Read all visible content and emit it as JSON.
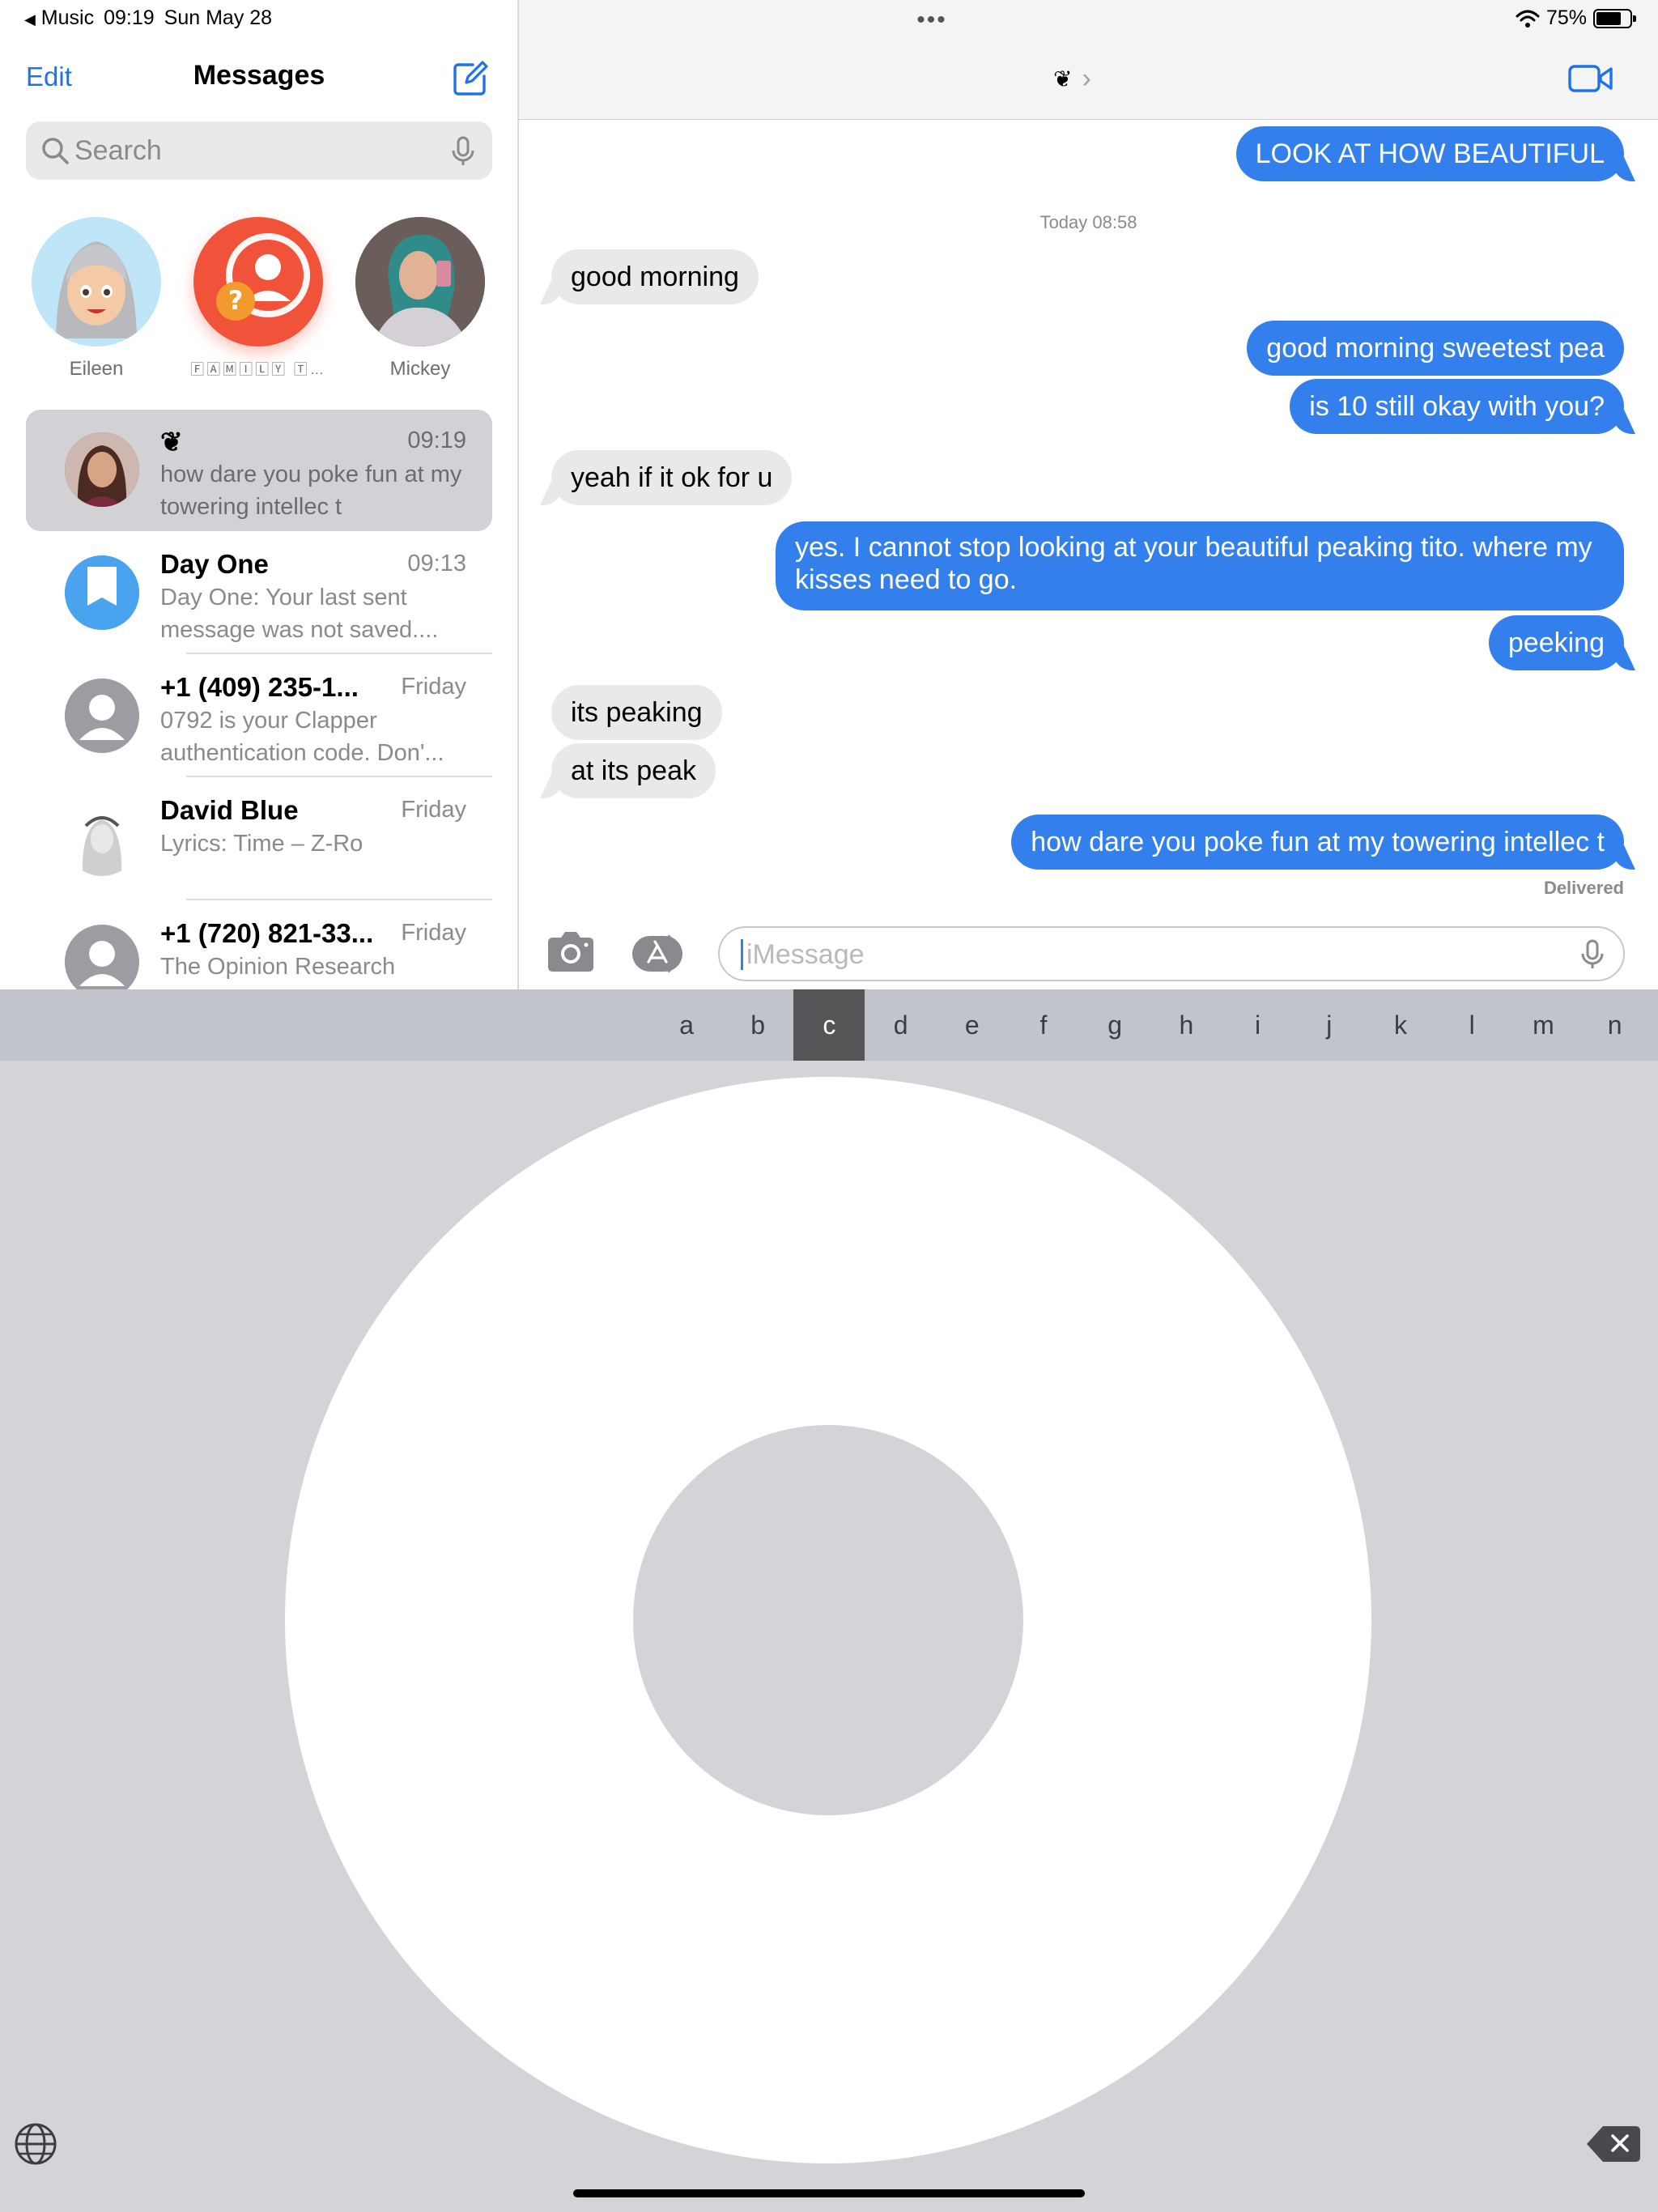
{
  "status_bar": {
    "back_app": "Music",
    "time": "09:19",
    "date": "Sun May 28",
    "battery": "75%",
    "battery_level": 0.75
  },
  "sidebar": {
    "edit_label": "Edit",
    "title": "Messages",
    "search_placeholder": "Search",
    "pinned": [
      {
        "name": "Eileen"
      },
      {
        "name": "🄵🄰🄼🄸🄻🅈 🅃…"
      },
      {
        "name": "Mickey"
      }
    ],
    "conversations": [
      {
        "name": "❦",
        "time": "09:19",
        "preview": "how dare you poke fun at my towering intellec t"
      },
      {
        "name": "Day One",
        "time": "09:13",
        "preview": "Day One: Your last sent message was not saved...."
      },
      {
        "name": "+1 (409) 235-1...",
        "time": "Friday",
        "preview": "0792 is your Clapper authentication code. Don'..."
      },
      {
        "name": "David Blue",
        "time": "Friday",
        "preview": "Lyrics: Time – Z-Ro"
      },
      {
        "name": "+1 (720) 821-33...",
        "time": "Friday",
        "preview": "The Opinion Research Institute is conducting..."
      }
    ]
  },
  "chat": {
    "header_dots": "•••",
    "contact_name": "❦",
    "chevron": "›",
    "messages": [
      {
        "text": "LOOK AT HOW BEAUTIFUL",
        "from": "me"
      },
      {
        "text": "good morning",
        "from": "them"
      },
      {
        "text": "good morning sweetest pea",
        "from": "me"
      },
      {
        "text": "is 10 still okay with you?",
        "from": "me"
      },
      {
        "text": "yeah if it ok for u",
        "from": "them"
      },
      {
        "text": "yes. I cannot stop looking at your beautiful peaking tito. where my kisses need to go.",
        "from": "me"
      },
      {
        "text": "peeking",
        "from": "me"
      },
      {
        "text": "its peaking",
        "from": "them"
      },
      {
        "text": "at its peak",
        "from": "them"
      },
      {
        "text": "how dare you poke fun at my towering intellec t",
        "from": "me"
      }
    ],
    "timestamp": "Today 08:58",
    "delivered": "Delivered",
    "input_placeholder": "iMessage"
  },
  "keyboard": {
    "letters": [
      "a",
      "b",
      "c",
      "d",
      "e",
      "f",
      "g",
      "h",
      "i",
      "j",
      "k",
      "l",
      "m",
      "n"
    ],
    "active_letter": "c"
  },
  "colors": {
    "accent": "#1f72e8",
    "sent_bubble": "#3380ec",
    "recv_bubble": "#e9e9eb",
    "keyboard_bg": "#d3d4d8"
  }
}
